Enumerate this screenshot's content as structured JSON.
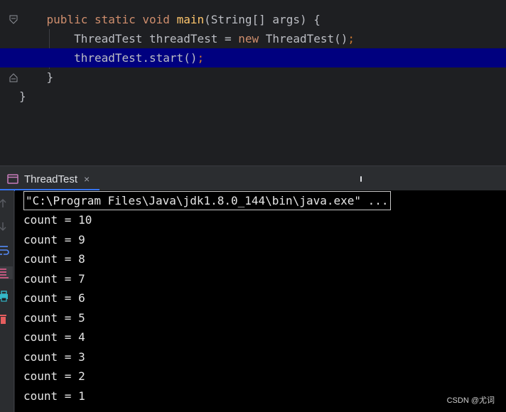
{
  "editor": {
    "lines": [
      {
        "indent": "    ",
        "tokens": [
          {
            "t": "public static void ",
            "c": "kw"
          },
          {
            "t": "main",
            "c": "fn"
          },
          {
            "t": "(String[] args) {",
            "c": "plain"
          }
        ]
      },
      {
        "indent": "        ",
        "tokens": [
          {
            "t": "ThreadTest threadTest = ",
            "c": "plain"
          },
          {
            "t": "new ",
            "c": "kw"
          },
          {
            "t": "ThreadTest()",
            "c": "plain"
          },
          {
            "t": ";",
            "c": "punc"
          }
        ]
      },
      {
        "indent": "        ",
        "current": true,
        "tokens": [
          {
            "t": "threadTest.start()",
            "c": "plain"
          },
          {
            "t": ";",
            "c": "punc"
          }
        ]
      },
      {
        "indent": "    ",
        "tokens": [
          {
            "t": "}",
            "c": "plain"
          }
        ]
      },
      {
        "indent": "",
        "tokens": [
          {
            "t": "}",
            "c": "plain"
          }
        ]
      }
    ]
  },
  "run_panel": {
    "tab_label": "ThreadTest",
    "tab_close": "×",
    "command_line": "\"C:\\Program Files\\Java\\jdk1.8.0_144\\bin\\java.exe\" ...",
    "output": [
      "count = 10",
      "count = 9",
      "count = 8",
      "count = 7",
      "count = 6",
      "count = 5",
      "count = 4",
      "count = 3",
      "count = 2",
      "count = 1"
    ],
    "tools": [
      "up-arrow-icon",
      "down-arrow-icon",
      "soft-wrap-icon",
      "scroll-to-end-icon",
      "print-icon",
      "trash-icon"
    ]
  },
  "watermark": "CSDN @尤词",
  "colors": {
    "keyword": "#cf8e6d",
    "method": "#ffc66d",
    "current_line": "#00007f",
    "console_bg": "#000000"
  }
}
